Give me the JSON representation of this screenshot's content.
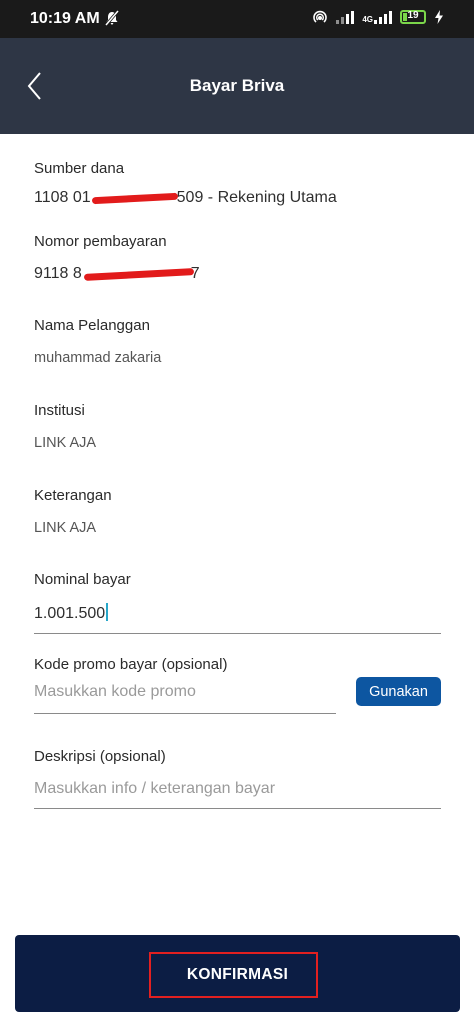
{
  "status_bar": {
    "time": "10:19 AM",
    "network_label": "4G",
    "battery_level": "19",
    "battery_fraction": 0.19
  },
  "header": {
    "title": "Bayar Briva"
  },
  "form": {
    "sumber_dana": {
      "label": "Sumber dana",
      "value_start": "1108 01",
      "value_end": "509 - Rekening Utama"
    },
    "nomor_pembayaran": {
      "label": "Nomor pembayaran",
      "value_start": "9118 8",
      "value_end": "7"
    },
    "nama_pelanggan": {
      "label": "Nama Pelanggan",
      "value": "muhammad zakaria"
    },
    "institusi": {
      "label": "Institusi",
      "value": "LINK AJA"
    },
    "keterangan": {
      "label": "Keterangan",
      "value": "LINK AJA"
    },
    "nominal_bayar": {
      "label": "Nominal bayar",
      "value": "1.001.500"
    },
    "kode_promo": {
      "label": "Kode promo bayar (opsional)",
      "placeholder": "Masukkan kode promo",
      "button": "Gunakan"
    },
    "deskripsi": {
      "label": "Deskripsi (opsional)",
      "placeholder": "Masukkan info / keterangan bayar"
    }
  },
  "footer": {
    "confirm_label": "KONFIRMASI"
  },
  "colors": {
    "app_bar": "#2e3645",
    "footer_button": "#0c1d44",
    "accent_button": "#0d56a1",
    "highlight": "#e32020"
  }
}
